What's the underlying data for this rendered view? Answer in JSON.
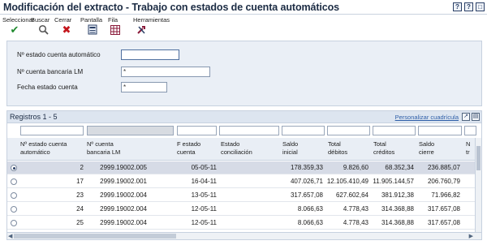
{
  "window": {
    "title": "Modificación del extracto - Trabajo con estados de cuenta automáticos",
    "buttons": [
      "?",
      "?",
      "□"
    ]
  },
  "toolbar": {
    "items": [
      {
        "label": "Seleccionar",
        "icon": "checkmark-icon",
        "glyph": "✔",
        "color": "#1f8a2e"
      },
      {
        "label": "Buscar",
        "icon": "search-icon",
        "glyph": "⌕",
        "color": "#444444"
      },
      {
        "label": "Cerrar",
        "icon": "close-icon",
        "glyph": "✖",
        "color": "#c4161c"
      },
      {
        "label": "Pantalla",
        "icon": "display-icon",
        "glyph": "▦",
        "color": "#2a3f66"
      },
      {
        "label": "Fila",
        "icon": "row-icon",
        "glyph": "▦",
        "color": "#8a1a3a"
      },
      {
        "label": "Herramientas",
        "icon": "tools-icon",
        "glyph": "⚒",
        "color": "#8a1a3a"
      }
    ]
  },
  "search": {
    "statement_label": "Nº estado cuenta automático",
    "statement_value": "",
    "bank_label": "Nº cuenta bancaria LM",
    "bank_value": "*",
    "date_label": "Fecha estado cuenta",
    "date_value": "*"
  },
  "grid": {
    "title": "Registros 1 - 5",
    "customize": "Personalizar cuadrícula",
    "columns": [
      "Nº estado cuenta\nautomático",
      "Nº cuenta\nbancaria LM",
      "F estado\ncuenta",
      "Estado\nconciliación",
      "Saldo\ninicial",
      "Total\ndébitos",
      "Total\ncréditos",
      "Saldo\ncierre",
      "N\ntr"
    ],
    "rows": [
      {
        "selected": true,
        "statement": "2",
        "bank": "2999.19002.005",
        "date": "05-05-11",
        "status": "",
        "opening": "178.359,33",
        "debits": "9.826,60",
        "credits": "68.352,34",
        "closing": "236.885,07"
      },
      {
        "selected": false,
        "statement": "17",
        "bank": "2999.19002.001",
        "date": "16-04-11",
        "status": "",
        "opening": "407.026,71",
        "debits": "12.105.410,49",
        "credits": "11.905.144,57",
        "closing": "206.760,79"
      },
      {
        "selected": false,
        "statement": "23",
        "bank": "2999.19002.004",
        "date": "13-05-11",
        "status": "",
        "opening": "317.657,08",
        "debits": "627.602,64",
        "credits": "381.912,38",
        "closing": "71.966,82"
      },
      {
        "selected": false,
        "statement": "24",
        "bank": "2999.19002.004",
        "date": "12-05-11",
        "status": "",
        "opening": "8.066,63",
        "debits": "4.778,43",
        "credits": "314.368,88",
        "closing": "317.657,08"
      },
      {
        "selected": false,
        "statement": "25",
        "bank": "2999.19002.004",
        "date": "12-05-11",
        "status": "",
        "opening": "8.066,63",
        "debits": "4.778,43",
        "credits": "314.368,88",
        "closing": "317.657,08"
      }
    ]
  }
}
